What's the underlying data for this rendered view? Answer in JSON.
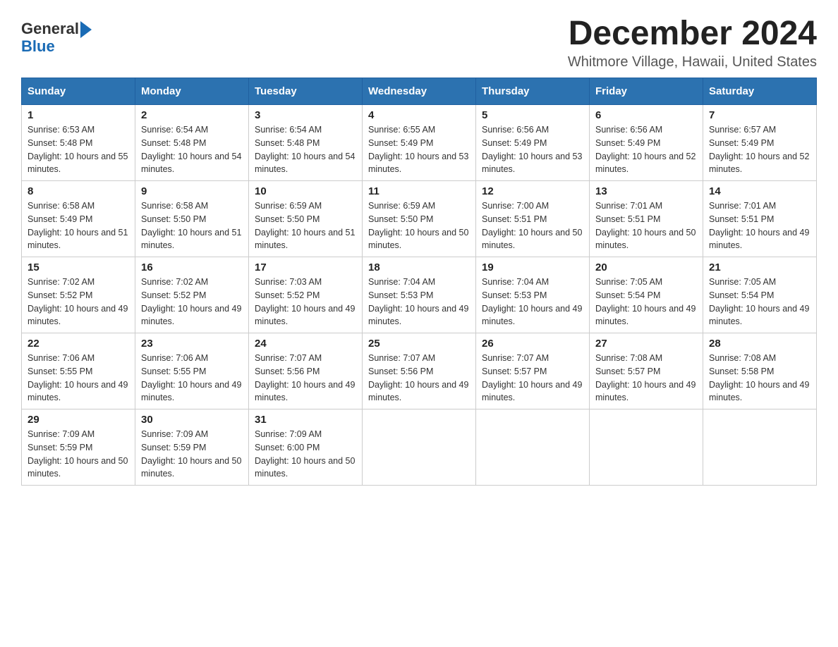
{
  "header": {
    "logo_general": "General",
    "logo_blue": "Blue",
    "month_title": "December 2024",
    "location": "Whitmore Village, Hawaii, United States"
  },
  "calendar": {
    "days_of_week": [
      "Sunday",
      "Monday",
      "Tuesday",
      "Wednesday",
      "Thursday",
      "Friday",
      "Saturday"
    ],
    "weeks": [
      [
        {
          "day": "1",
          "sunrise": "6:53 AM",
          "sunset": "5:48 PM",
          "daylight": "10 hours and 55 minutes."
        },
        {
          "day": "2",
          "sunrise": "6:54 AM",
          "sunset": "5:48 PM",
          "daylight": "10 hours and 54 minutes."
        },
        {
          "day": "3",
          "sunrise": "6:54 AM",
          "sunset": "5:48 PM",
          "daylight": "10 hours and 54 minutes."
        },
        {
          "day": "4",
          "sunrise": "6:55 AM",
          "sunset": "5:49 PM",
          "daylight": "10 hours and 53 minutes."
        },
        {
          "day": "5",
          "sunrise": "6:56 AM",
          "sunset": "5:49 PM",
          "daylight": "10 hours and 53 minutes."
        },
        {
          "day": "6",
          "sunrise": "6:56 AM",
          "sunset": "5:49 PM",
          "daylight": "10 hours and 52 minutes."
        },
        {
          "day": "7",
          "sunrise": "6:57 AM",
          "sunset": "5:49 PM",
          "daylight": "10 hours and 52 minutes."
        }
      ],
      [
        {
          "day": "8",
          "sunrise": "6:58 AM",
          "sunset": "5:49 PM",
          "daylight": "10 hours and 51 minutes."
        },
        {
          "day": "9",
          "sunrise": "6:58 AM",
          "sunset": "5:50 PM",
          "daylight": "10 hours and 51 minutes."
        },
        {
          "day": "10",
          "sunrise": "6:59 AM",
          "sunset": "5:50 PM",
          "daylight": "10 hours and 51 minutes."
        },
        {
          "day": "11",
          "sunrise": "6:59 AM",
          "sunset": "5:50 PM",
          "daylight": "10 hours and 50 minutes."
        },
        {
          "day": "12",
          "sunrise": "7:00 AM",
          "sunset": "5:51 PM",
          "daylight": "10 hours and 50 minutes."
        },
        {
          "day": "13",
          "sunrise": "7:01 AM",
          "sunset": "5:51 PM",
          "daylight": "10 hours and 50 minutes."
        },
        {
          "day": "14",
          "sunrise": "7:01 AM",
          "sunset": "5:51 PM",
          "daylight": "10 hours and 49 minutes."
        }
      ],
      [
        {
          "day": "15",
          "sunrise": "7:02 AM",
          "sunset": "5:52 PM",
          "daylight": "10 hours and 49 minutes."
        },
        {
          "day": "16",
          "sunrise": "7:02 AM",
          "sunset": "5:52 PM",
          "daylight": "10 hours and 49 minutes."
        },
        {
          "day": "17",
          "sunrise": "7:03 AM",
          "sunset": "5:52 PM",
          "daylight": "10 hours and 49 minutes."
        },
        {
          "day": "18",
          "sunrise": "7:04 AM",
          "sunset": "5:53 PM",
          "daylight": "10 hours and 49 minutes."
        },
        {
          "day": "19",
          "sunrise": "7:04 AM",
          "sunset": "5:53 PM",
          "daylight": "10 hours and 49 minutes."
        },
        {
          "day": "20",
          "sunrise": "7:05 AM",
          "sunset": "5:54 PM",
          "daylight": "10 hours and 49 minutes."
        },
        {
          "day": "21",
          "sunrise": "7:05 AM",
          "sunset": "5:54 PM",
          "daylight": "10 hours and 49 minutes."
        }
      ],
      [
        {
          "day": "22",
          "sunrise": "7:06 AM",
          "sunset": "5:55 PM",
          "daylight": "10 hours and 49 minutes."
        },
        {
          "day": "23",
          "sunrise": "7:06 AM",
          "sunset": "5:55 PM",
          "daylight": "10 hours and 49 minutes."
        },
        {
          "day": "24",
          "sunrise": "7:07 AM",
          "sunset": "5:56 PM",
          "daylight": "10 hours and 49 minutes."
        },
        {
          "day": "25",
          "sunrise": "7:07 AM",
          "sunset": "5:56 PM",
          "daylight": "10 hours and 49 minutes."
        },
        {
          "day": "26",
          "sunrise": "7:07 AM",
          "sunset": "5:57 PM",
          "daylight": "10 hours and 49 minutes."
        },
        {
          "day": "27",
          "sunrise": "7:08 AM",
          "sunset": "5:57 PM",
          "daylight": "10 hours and 49 minutes."
        },
        {
          "day": "28",
          "sunrise": "7:08 AM",
          "sunset": "5:58 PM",
          "daylight": "10 hours and 49 minutes."
        }
      ],
      [
        {
          "day": "29",
          "sunrise": "7:09 AM",
          "sunset": "5:59 PM",
          "daylight": "10 hours and 50 minutes."
        },
        {
          "day": "30",
          "sunrise": "7:09 AM",
          "sunset": "5:59 PM",
          "daylight": "10 hours and 50 minutes."
        },
        {
          "day": "31",
          "sunrise": "7:09 AM",
          "sunset": "6:00 PM",
          "daylight": "10 hours and 50 minutes."
        },
        null,
        null,
        null,
        null
      ]
    ],
    "labels": {
      "sunrise": "Sunrise: ",
      "sunset": "Sunset: ",
      "daylight": "Daylight: "
    }
  }
}
